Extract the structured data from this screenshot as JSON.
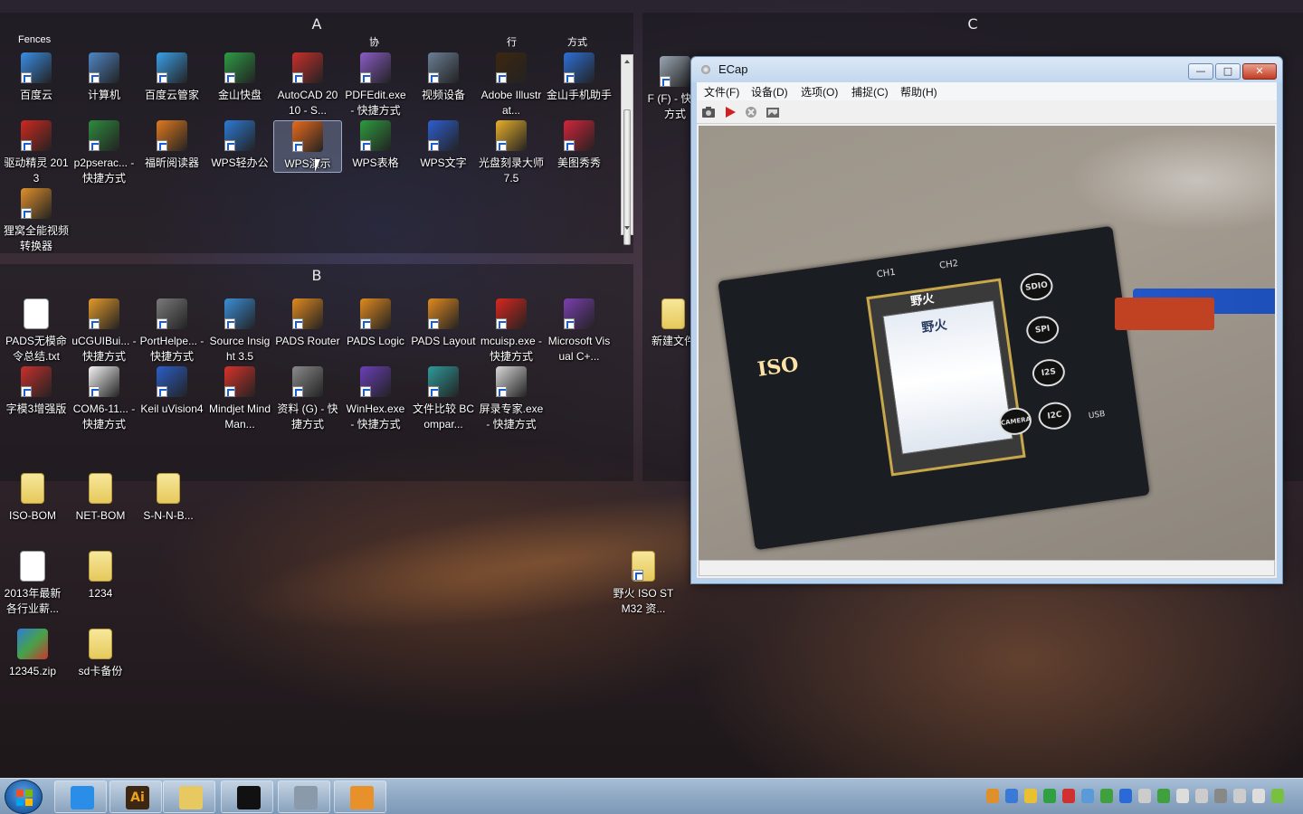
{
  "fences": [
    {
      "title": "A",
      "partial_top": [
        "Fences",
        "协",
        "行",
        "方式"
      ]
    },
    {
      "title": "B"
    },
    {
      "title": "C"
    }
  ],
  "fence_a_icons": [
    {
      "name": "baidu-cloud",
      "label": "百度云",
      "color": "#3a8ee6"
    },
    {
      "name": "computer",
      "label": "计算机",
      "color": "#4f86c6"
    },
    {
      "name": "baidu-cloud-manager",
      "label": "百度云管家",
      "color": "#3aa0e8"
    },
    {
      "name": "kingsoft-kuaipan",
      "label": "金山快盘",
      "color": "#2e9b45"
    },
    {
      "name": "autocad",
      "label": "AutoCAD 2010 - S...",
      "color": "#c9302c"
    },
    {
      "name": "pdfedit",
      "label": "PDFEdit.exe - 快捷方式",
      "color": "#8b5cc6"
    },
    {
      "name": "video-device",
      "label": "视频设备",
      "color": "#6b7f95"
    },
    {
      "name": "adobe-illustrator",
      "label": "Adobe Illustrat...",
      "color": "#3d2710"
    },
    {
      "name": "kingsoft-phone-assistant",
      "label": "金山手机助手",
      "color": "#2d6fd6"
    },
    {
      "name": "driver-genius",
      "label": "驱动精灵 2013",
      "color": "#d0281f"
    },
    {
      "name": "p2psearcher",
      "label": "p2pserac... - 快捷方式",
      "color": "#2e8b3e"
    },
    {
      "name": "foxit-reader",
      "label": "福昕阅读器",
      "color": "#e07a1f"
    },
    {
      "name": "wps-office",
      "label": "WPS轻办公",
      "color": "#2d7ad6"
    },
    {
      "name": "wps-presentation",
      "label": "WPS演示",
      "color": "#e86a1c"
    },
    {
      "name": "wps-spreadsheet",
      "label": "WPS表格",
      "color": "#2e9b3e"
    },
    {
      "name": "wps-writer",
      "label": "WPS文字",
      "color": "#2d5fd0"
    },
    {
      "name": "nero-burner",
      "label": "光盘刻录大师 7.5",
      "color": "#e8b02a"
    },
    {
      "name": "meitu",
      "label": "美图秀秀",
      "color": "#d4243a"
    },
    {
      "name": "video-converter",
      "label": "狸窝全能视频转换器",
      "color": "#e0902a"
    }
  ],
  "fence_b_icons": [
    {
      "name": "pads-doc",
      "label": "PADS无模命令总结.txt",
      "color": "#ffffff"
    },
    {
      "name": "ucguibuilder",
      "label": "uCGUIBui... - 快捷方式",
      "color": "#e39a2a"
    },
    {
      "name": "porthelper",
      "label": "PortHelpe... - 快捷方式",
      "color": "#7a7a7a"
    },
    {
      "name": "source-insight",
      "label": "Source Insight 3.5",
      "color": "#3b8fd8"
    },
    {
      "name": "pads-router",
      "label": "PADS Router",
      "color": "#e08a1e"
    },
    {
      "name": "pads-logic",
      "label": "PADS Logic",
      "color": "#e08a1e"
    },
    {
      "name": "pads-layout",
      "label": "PADS Layout",
      "color": "#e08a1e"
    },
    {
      "name": "mcuisp",
      "label": "mcuisp.exe - 快捷方式",
      "color": "#d9261f"
    },
    {
      "name": "visual-cpp",
      "label": "Microsoft Visual C+...",
      "color": "#7a3fb0"
    },
    {
      "name": "font-modulo",
      "label": "字模3增强版",
      "color": "#c8302c"
    },
    {
      "name": "com6",
      "label": "COM6-11... - 快捷方式",
      "color": "#f4f4f4"
    },
    {
      "name": "keil",
      "label": "Keil uVision4",
      "color": "#2b5fc9"
    },
    {
      "name": "mindjet",
      "label": "Mindjet MindMan...",
      "color": "#d8322a"
    },
    {
      "name": "data-drive",
      "label": "资料 (G) - 快捷方式",
      "color": "#8a8a8a"
    },
    {
      "name": "winhex",
      "label": "WinHex.exe - 快捷方式",
      "color": "#6a3fb8"
    },
    {
      "name": "beyond-compare",
      "label": "文件比较 BCompar...",
      "color": "#2e9b9b"
    },
    {
      "name": "screen-recorder",
      "label": "屏录专家.exe - 快捷方式",
      "color": "#d8d8d8"
    }
  ],
  "fence_c_icons": [
    {
      "name": "drive-f",
      "label": "F (F) - 快捷方式",
      "color": "#9aa7b4"
    },
    {
      "name": "new-folder",
      "label": "新建文件",
      "color": "#e8cf6a"
    }
  ],
  "loose_icons": [
    {
      "name": "iso-bom",
      "label": "ISO-BOM",
      "kind": "folder"
    },
    {
      "name": "net-bom",
      "label": "NET-BOM",
      "kind": "folder"
    },
    {
      "name": "snnb",
      "label": "S-N-N-B...",
      "kind": "folder"
    },
    {
      "name": "industry-salary",
      "label": "2013年最新各行业薪...",
      "kind": "doc"
    },
    {
      "name": "folder-1234",
      "label": "1234",
      "kind": "folder"
    },
    {
      "name": "zip-12345",
      "label": "12345.zip",
      "kind": "zip"
    },
    {
      "name": "sd-backup",
      "label": "sd卡备份",
      "kind": "folder"
    },
    {
      "name": "yehuo-iso",
      "label": "野火 ISO STM32 资...",
      "kind": "folder"
    }
  ],
  "ecap": {
    "title": "ECap",
    "menu": [
      "文件(F)",
      "设备(D)",
      "选项(O)",
      "捕捉(C)",
      "帮助(H)"
    ],
    "toolbar": [
      "camera-icon",
      "record-icon",
      "stop-icon",
      "image-icon"
    ],
    "video": {
      "board_title": "野火",
      "board_label": "ISO",
      "ch_labels": [
        "CH1",
        "CH2"
      ],
      "chip_labels": [
        "SDIO",
        "SPI",
        "I2S",
        "I2C",
        "CAMERA",
        "USB"
      ],
      "lcd_text": "野火"
    }
  },
  "window_controls": {
    "minimize": "—",
    "maximize": "□",
    "close": "✕"
  },
  "taskbar": {
    "start": "start-button",
    "items": [
      {
        "name": "internet-explorer",
        "color": "#2a8ee8"
      },
      {
        "name": "adobe-illustrator",
        "label": "Ai",
        "color": "#3d2710"
      },
      {
        "name": "file-explorer",
        "color": "#e8c860"
      },
      {
        "name": "cmd",
        "color": "#111111"
      },
      {
        "name": "webcam",
        "color": "#8a9aaa"
      },
      {
        "name": "unknown-app",
        "color": "#e8902a"
      }
    ],
    "tray_count": 16
  }
}
